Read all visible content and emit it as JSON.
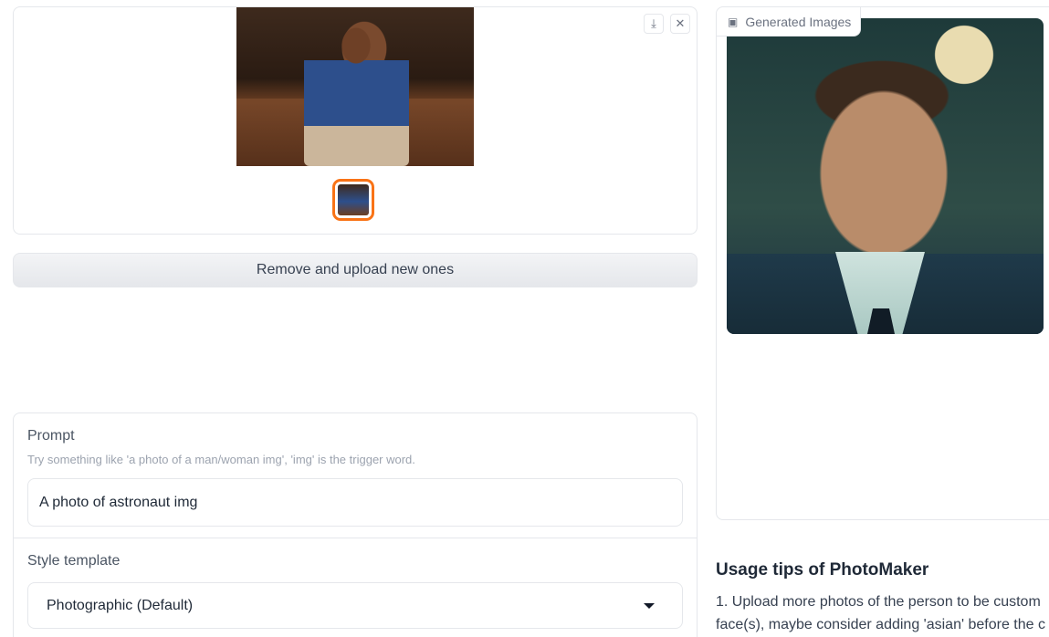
{
  "upload_gallery": {
    "download_icon": "download-icon",
    "close_icon": "close-icon",
    "download_glyph": "⤓",
    "close_glyph": "✕"
  },
  "remove_button_label": "Remove and upload new ones",
  "prompt": {
    "label": "Prompt",
    "info": "Try something like 'a photo of a man/woman img', 'img' is the trigger word.",
    "value": "A photo of astronaut img"
  },
  "style_template": {
    "label": "Style template",
    "selected": "Photographic (Default)"
  },
  "generated": {
    "label": "Generated Images",
    "icon": "image-icon",
    "icon_glyph": "▣"
  },
  "usage_tips": {
    "title": "Usage tips of PhotoMaker",
    "line1": "1. Upload more photos of the person to be custom",
    "line2": "face(s), maybe consider adding 'asian' before the c"
  },
  "colors": {
    "accent": "#f97316",
    "border": "#e5e7eb"
  }
}
